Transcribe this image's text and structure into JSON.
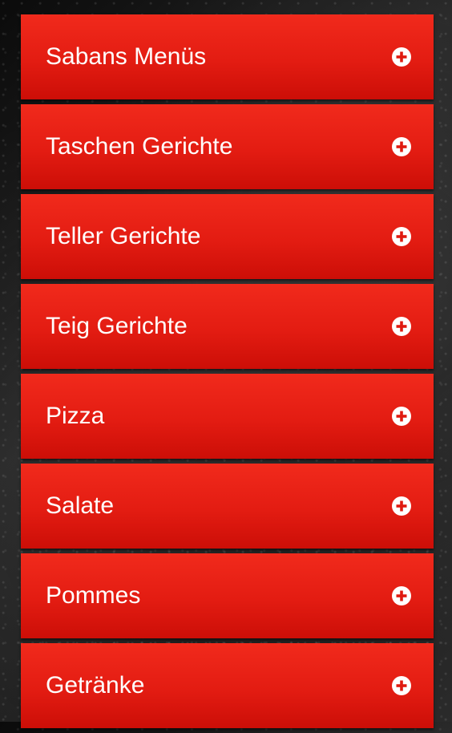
{
  "menu": {
    "items": [
      {
        "label": "Sabans Menüs",
        "icon": "plus-circle-icon"
      },
      {
        "label": "Taschen Gerichte",
        "icon": "plus-circle-icon"
      },
      {
        "label": "Teller Gerichte",
        "icon": "plus-circle-icon"
      },
      {
        "label": "Teig Gerichte",
        "icon": "plus-circle-icon"
      },
      {
        "label": "Pizza",
        "icon": "plus-circle-icon"
      },
      {
        "label": "Salate",
        "icon": "plus-circle-icon"
      },
      {
        "label": "Pommes",
        "icon": "plus-circle-icon"
      },
      {
        "label": "Getränke",
        "icon": "plus-circle-icon"
      }
    ]
  },
  "colors": {
    "item_top": "#f12a1c",
    "item_bottom": "#cc0e07",
    "text": "#ffffff"
  }
}
